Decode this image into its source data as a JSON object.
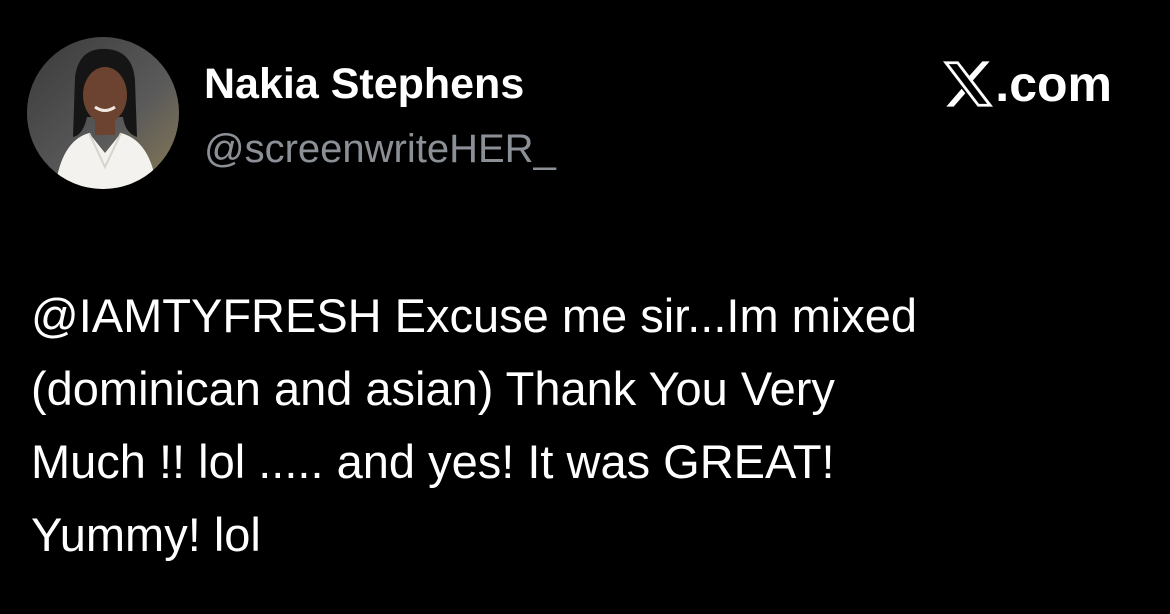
{
  "author": {
    "display_name": "Nakia Stephens",
    "handle": "@screenwriteHER_",
    "avatar_icon": "profile-photo"
  },
  "brand": {
    "icon": "x-logo-icon",
    "domain": ".com"
  },
  "tweet": {
    "text": "@IAMTYFRESH Excuse me sir...Im mixed\n(dominican and asian) Thank You Very\nMuch !! lol ..... and yes! It was GREAT!\nYummy! lol"
  },
  "colors": {
    "background": "#000000",
    "primary_text": "#ffffff",
    "secondary_text": "#8b9096"
  }
}
